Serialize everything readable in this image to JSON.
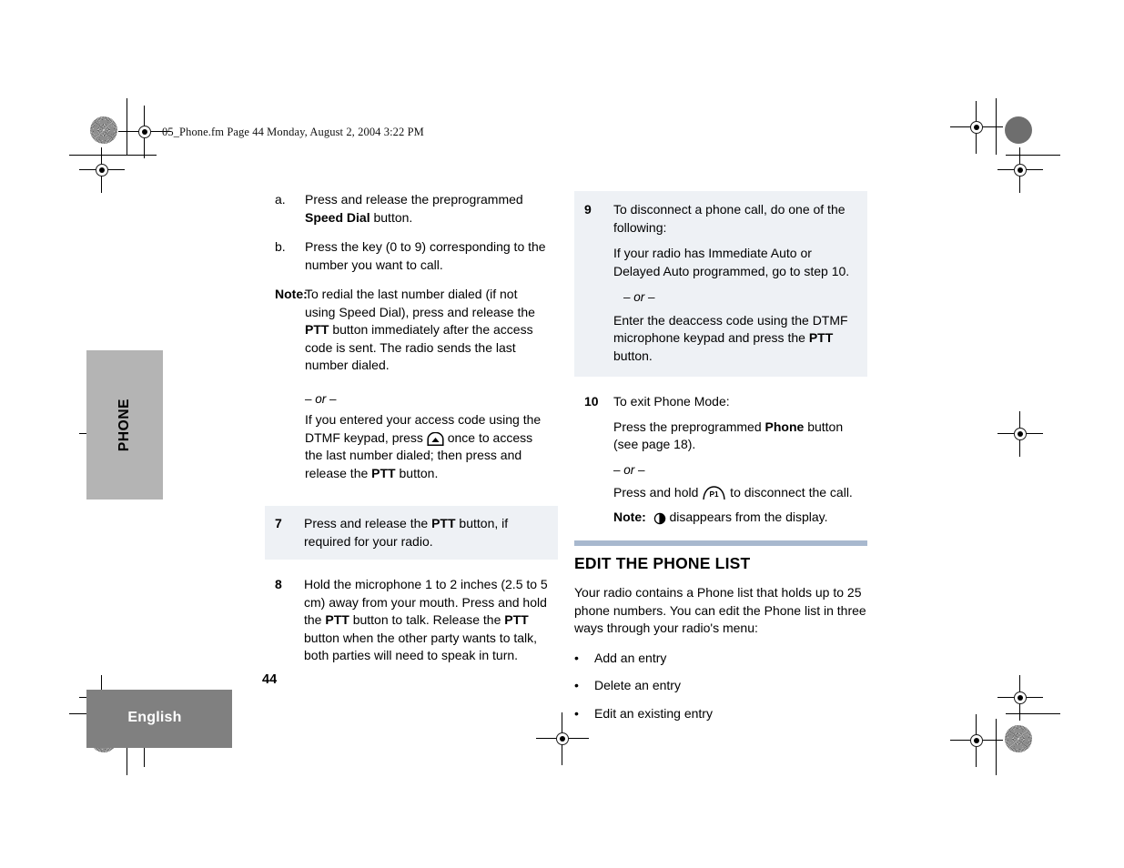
{
  "document": {
    "running_header": "05_Phone.fm  Page 44  Monday, August 2, 2004  3:22 PM",
    "page_number": "44",
    "side_tab_label": "PHONE",
    "language_tab_label": "English"
  },
  "left_column": {
    "substep_a": {
      "marker": "a.",
      "text_before": "Press and release the preprogrammed ",
      "bold": "Speed Dial",
      "text_after": " button."
    },
    "substep_b": {
      "marker": "b.",
      "text": "Press the key (0 to 9) corresponding to the number you want to call."
    },
    "note_1": {
      "marker": "Note:",
      "text_1": "To redial the last number dialed (if not using Speed Dial), press and release the ",
      "bold_1": "PTT",
      "text_2": " button immediately after the access code is sent. The radio sends the last number dialed."
    },
    "or_1": "– or –",
    "note_1_alt": {
      "text_1": "If you entered your access code using the DTMF keypad, press ",
      "icon": "dtmf-up-button-icon",
      "text_2": " once to access the last number dialed; then press and release the ",
      "bold_1": "PTT",
      "text_3": " button."
    },
    "step_7": {
      "number": "7",
      "text_1": "Press and release the ",
      "bold_1": "PTT",
      "text_2": " button, if required for your radio.",
      "shaded": true
    },
    "step_8": {
      "number": "8",
      "text_1": "Hold the microphone 1 to 2 inches (2.5 to 5 cm) away from your mouth. Press and hold the ",
      "bold_1": "PTT",
      "text_2": " button to talk. Release the ",
      "bold_2": "PTT",
      "text_3": " button when the other party wants to talk, both parties will need to speak in turn.",
      "shaded": false
    }
  },
  "right_column": {
    "step_9": {
      "number": "9",
      "line_1": "To disconnect a phone call, do one of the following:",
      "line_2": "If your radio has Immediate Auto or Delayed Auto programmed, go to step 10.",
      "or": "– or –",
      "line_3_a": "Enter the deaccess code using the DTMF microphone keypad and press the ",
      "line_3_bold": "PTT",
      "line_3_b": " button.",
      "shaded": true
    },
    "step_10": {
      "number": "10",
      "line_1": "To exit Phone Mode:",
      "line_2_a": "Press the preprogrammed ",
      "line_2_bold": "Phone",
      "line_2_b": " button (see page 18).",
      "or": "– or –",
      "line_3_a": "Press and hold ",
      "line_3_icon": "p1-button-icon",
      "line_3_b": " to disconnect the call.",
      "note_marker": "Note:",
      "note_icon": "phone-in-use-indicator-icon",
      "note_text": " disappears from the display.",
      "shaded": false
    },
    "section": {
      "title": "EDIT THE PHONE LIST",
      "paragraph": "Your radio contains a Phone list that holds up to 25 phone numbers. You can edit the Phone list in three ways through your radio's menu:",
      "bullet_marker": "•",
      "bullets": [
        "Add an entry",
        "Delete an entry",
        "Edit an existing entry"
      ]
    }
  },
  "colors": {
    "shaded_box": "#eef1f5",
    "section_rule": "#a8b8ce",
    "side_tab": "#b4b4b4",
    "language_tab": "#808080"
  }
}
